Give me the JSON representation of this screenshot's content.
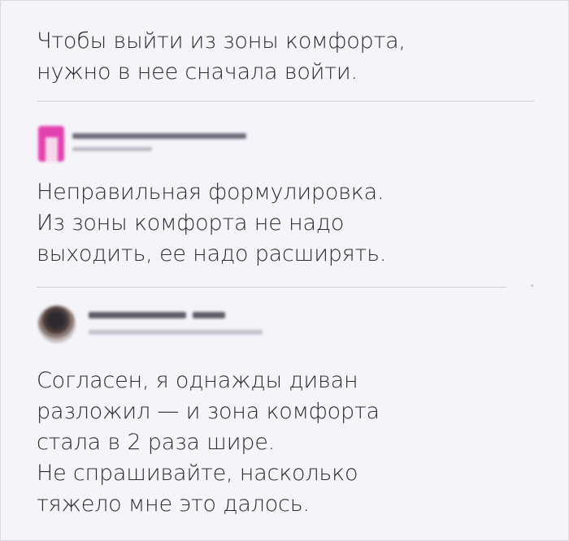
{
  "posts": [
    {
      "text": "Чтобы выйти из зоны комфорта,\nнужно в нее сначала войти."
    },
    {
      "avatar_icon": "user-avatar-pink-icon",
      "text": "Неправильная формулировка.\nИз зоны комфорта не надо\nвыходить, ее надо расширять."
    },
    {
      "avatar_icon": "user-avatar-photo-icon",
      "text": "Согласен, я однажды диван\nразложил — и зона комфорта\nстала в 2 раза шире.\nНе спрашивайте, насколько\nтяжело мне это далось."
    }
  ],
  "colors": {
    "background": "#f4f4f9",
    "text": "#2c2c35",
    "divider": "#cfcfd8",
    "avatar_pink": "#e441b0"
  }
}
